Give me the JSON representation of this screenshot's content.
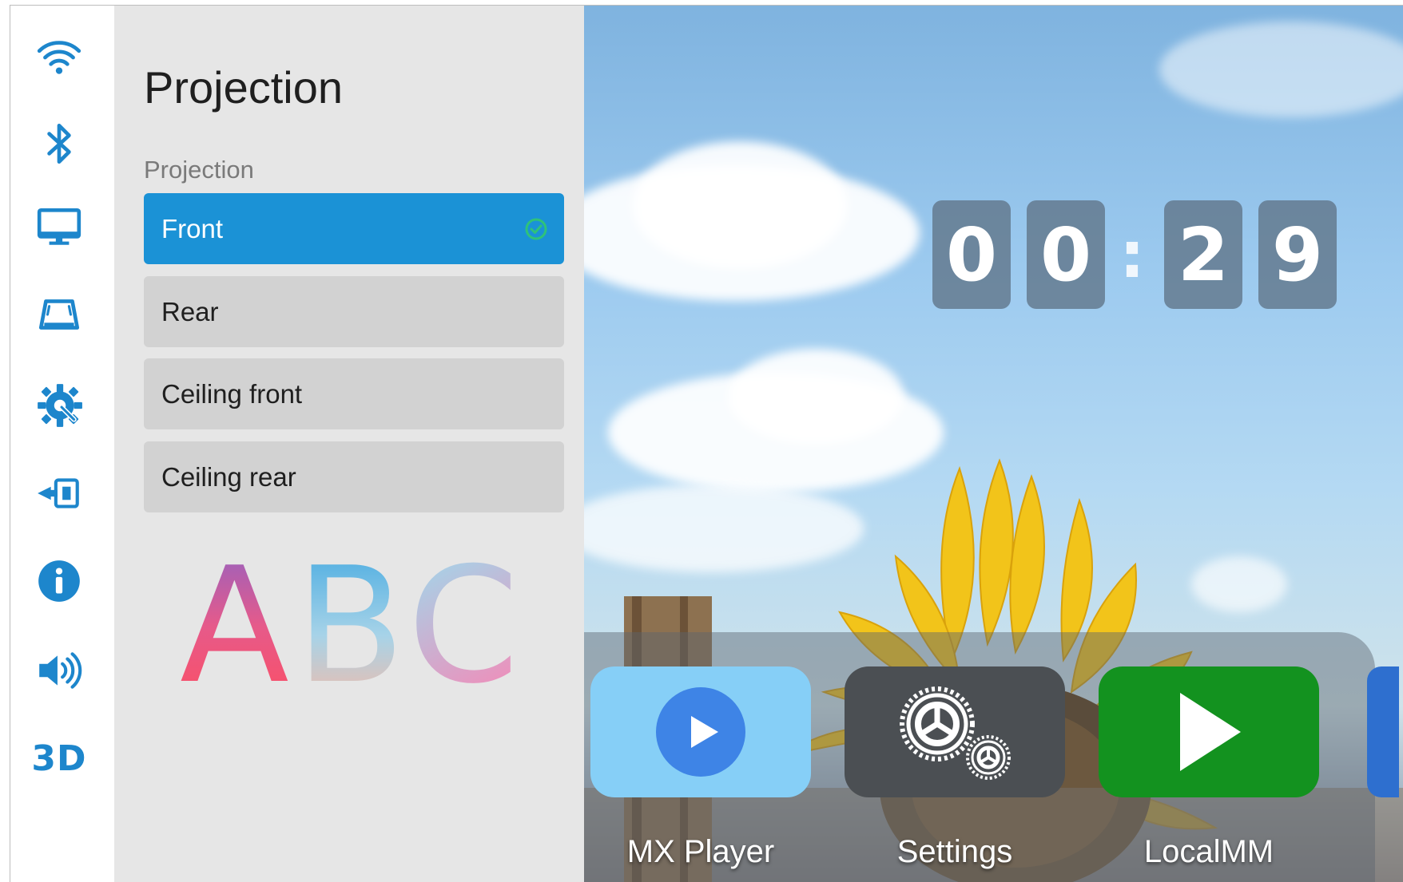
{
  "sidebar": {
    "items": [
      {
        "id": "wifi",
        "icon": "wifi-icon"
      },
      {
        "id": "bluetooth",
        "icon": "bluetooth-icon"
      },
      {
        "id": "display",
        "icon": "monitor-icon"
      },
      {
        "id": "keystone",
        "icon": "keystone-icon"
      },
      {
        "id": "settings",
        "icon": "gear-wrench-icon"
      },
      {
        "id": "input",
        "icon": "input-source-icon"
      },
      {
        "id": "info",
        "icon": "info-icon"
      },
      {
        "id": "sound",
        "icon": "speaker-icon"
      },
      {
        "id": "3d",
        "label": "3D"
      }
    ],
    "accent_color": "#1d86cc"
  },
  "panel": {
    "title": "Projection",
    "section_label": "Projection",
    "options": [
      {
        "label": "Front",
        "selected": true
      },
      {
        "label": "Rear",
        "selected": false
      },
      {
        "label": "Ceiling front",
        "selected": false
      },
      {
        "label": "Ceiling rear",
        "selected": false
      }
    ],
    "preview_text": "ABC",
    "selected_color": "#1b92d6",
    "check_color": "#2fc27a"
  },
  "clock": {
    "digits": [
      "0",
      "0",
      "2",
      "9"
    ],
    "separator": ":"
  },
  "dock": {
    "apps": [
      {
        "label": "MX Player",
        "icon": "play-circle-icon",
        "bg": "#86cff7"
      },
      {
        "label": "Settings",
        "icon": "gears-icon",
        "bg": "#4b4f53"
      },
      {
        "label": "LocalMM",
        "icon": "play-triangle-icon",
        "bg": "#13921f"
      }
    ]
  }
}
